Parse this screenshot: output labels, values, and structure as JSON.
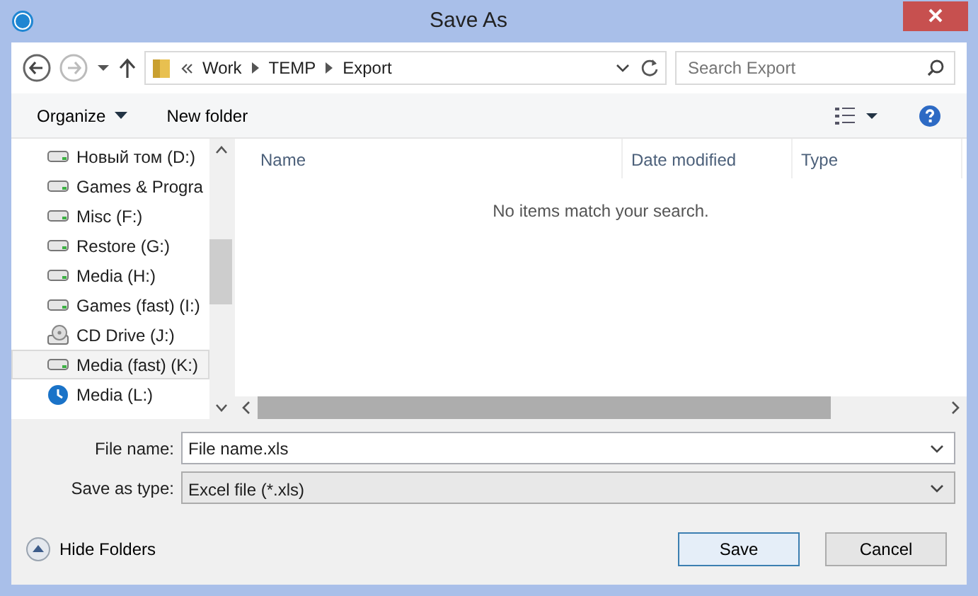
{
  "window": {
    "title": "Save As"
  },
  "address_bar": {
    "path": [
      "Work",
      "TEMP",
      "Export"
    ]
  },
  "search": {
    "placeholder": "Search Export"
  },
  "toolbar": {
    "organize": "Organize",
    "new_folder": "New folder"
  },
  "sidebar": {
    "items": [
      {
        "label": "Новый том (D:)",
        "kind": "drive",
        "selected": false
      },
      {
        "label": "Games & Progra",
        "kind": "drive",
        "selected": false
      },
      {
        "label": "Misc (F:)",
        "kind": "drive",
        "selected": false
      },
      {
        "label": "Restore (G:)",
        "kind": "drive",
        "selected": false
      },
      {
        "label": "Media (H:)",
        "kind": "drive",
        "selected": false
      },
      {
        "label": "Games (fast) (I:)",
        "kind": "drive",
        "selected": false
      },
      {
        "label": "CD Drive (J:)",
        "kind": "cd",
        "selected": false
      },
      {
        "label": "Media (fast) (K:)",
        "kind": "drive",
        "selected": true
      },
      {
        "label": "Media (L:)",
        "kind": "clock",
        "selected": false
      }
    ]
  },
  "file_list": {
    "columns": [
      "Name",
      "Date modified",
      "Type"
    ],
    "empty_message": "No items match your search."
  },
  "form": {
    "file_name_label": "File name:",
    "file_name": "File name.xls",
    "type_label": "Save as type:",
    "type": "Excel file (*.xls)"
  },
  "hide_folders": "Hide Folders",
  "buttons": [
    {
      "label": "Save",
      "kind": "primary"
    },
    {
      "label": "Cancel",
      "kind": "secondary"
    }
  ]
}
